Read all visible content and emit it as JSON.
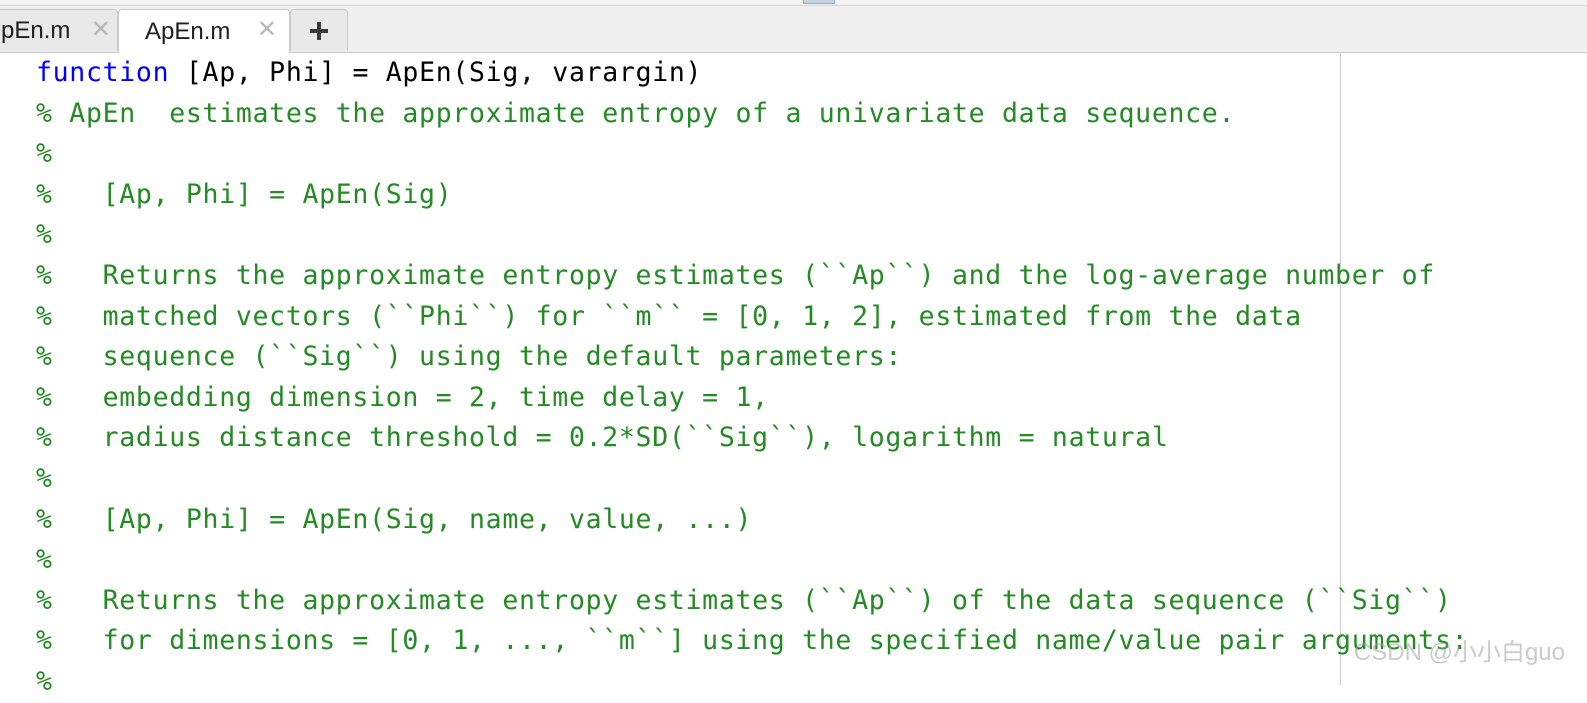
{
  "tabs": [
    {
      "label": "pEn.m",
      "active": false,
      "close_glyph": "✕"
    },
    {
      "label": "ApEn.m",
      "active": true,
      "close_glyph": "✕"
    }
  ],
  "add_tab_icon": "plus-icon",
  "code": {
    "line1": {
      "keyword": "function",
      "rest": " [Ap, Phi] = ApEn(Sig, varargin)"
    },
    "lines": [
      "% ApEn  estimates the approximate entropy of a univariate data sequence.",
      "%",
      "%   [Ap, Phi] = ApEn(Sig)",
      "%",
      "%   Returns the approximate entropy estimates (``Ap``) and the log-average number of",
      "%   matched vectors (``Phi``) for ``m`` = [0, 1, 2], estimated from the data",
      "%   sequence (``Sig``) using the default parameters:",
      "%   embedding dimension = 2, time delay = 1,",
      "%   radius distance threshold = 0.2*SD(``Sig``), logarithm = natural",
      "%",
      "%   [Ap, Phi] = ApEn(Sig, name, value, ...)",
      "%",
      "%   Returns the approximate entropy estimates (``Ap``) of the data sequence (``Sig``)",
      "%   for dimensions = [0, 1, ..., ``m``] using the specified name/value pair arguments:",
      "%"
    ]
  },
  "watermark": "CSDN @小小白guo",
  "colors": {
    "keyword": "#0000ff",
    "comment": "#228b22",
    "text": "#000000"
  }
}
